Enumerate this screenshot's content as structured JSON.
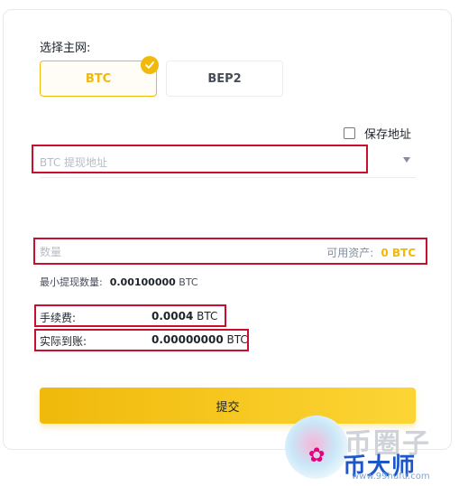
{
  "network": {
    "label": "选择主网:",
    "options": [
      {
        "label": "BTC",
        "selected": true
      },
      {
        "label": "BEP2",
        "selected": false
      }
    ]
  },
  "save_address": {
    "label": "保存地址",
    "checked": false
  },
  "address": {
    "placeholder": "BTC 提现地址",
    "value": ""
  },
  "amount": {
    "placeholder": "数量",
    "available_label": "可用资产:",
    "available_value": "0 BTC"
  },
  "min_withdraw": {
    "label": "最小提现数量:",
    "value": "0.00100000",
    "unit": "BTC"
  },
  "fee": {
    "label": "手续费:",
    "value": "0.0004",
    "unit": "BTC"
  },
  "received": {
    "label": "实际到账:",
    "value": "0.00000000",
    "unit": "BTC"
  },
  "submit": {
    "label": "提交"
  },
  "watermark": {
    "brand_top": "币圈子",
    "brand_main": "币大师",
    "url": "www.99hufu.com"
  },
  "colors": {
    "accent": "#f0b90b",
    "annotation": "#c8102e",
    "text": "#1e2329"
  }
}
